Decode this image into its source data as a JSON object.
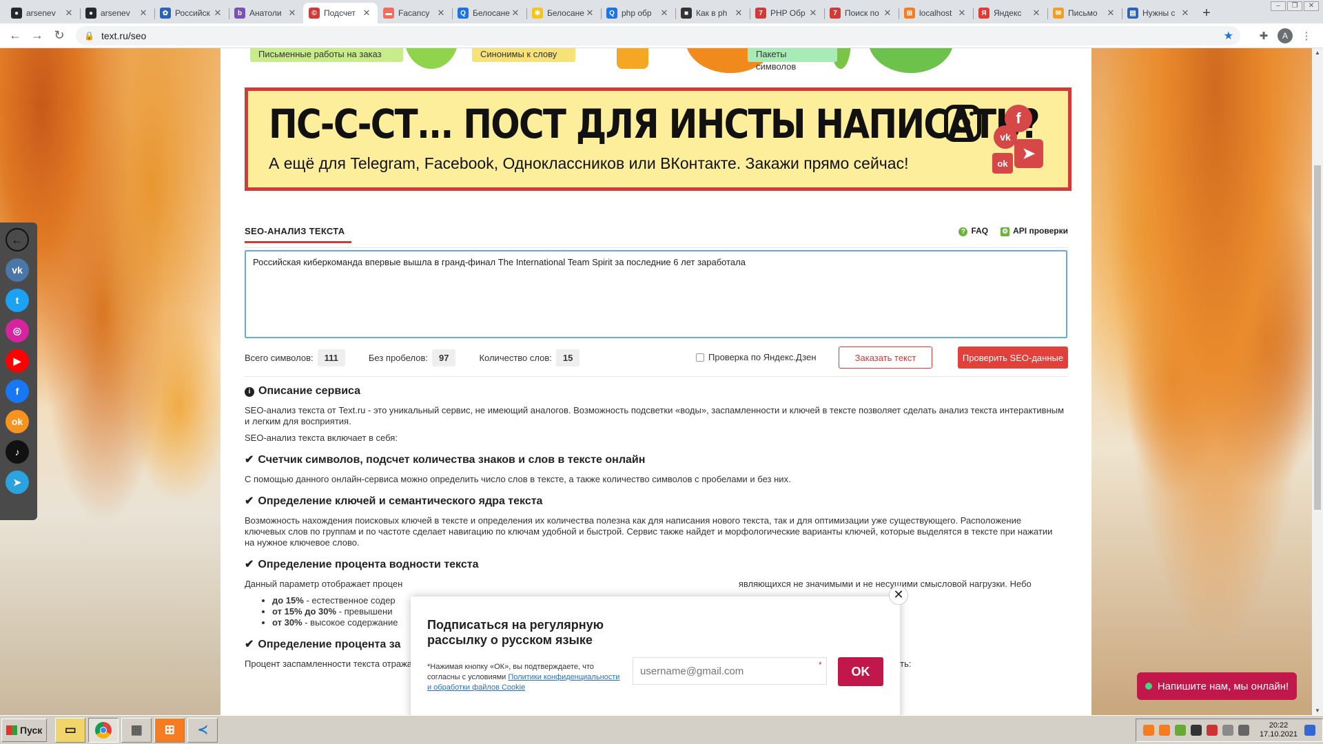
{
  "browser": {
    "tabs": [
      {
        "title": "arsenev",
        "icon": "github-icon",
        "color": "#24292e",
        "glyph": "●"
      },
      {
        "title": "arsenev",
        "icon": "github-icon",
        "color": "#24292e",
        "glyph": "●"
      },
      {
        "title": "Российск",
        "icon": "gosuslugi-icon",
        "color": "#2b63b6",
        "glyph": "✿"
      },
      {
        "title": "Анатоли",
        "icon": "bootstrap-icon",
        "color": "#7952b3",
        "glyph": "b"
      },
      {
        "title": "Подсчет",
        "icon": "textru-icon",
        "color": "#d23a3a",
        "glyph": "©",
        "active": true
      },
      {
        "title": "Facancy",
        "icon": "facancy-icon",
        "color": "#f26b5b",
        "glyph": "▬"
      },
      {
        "title": "Белосане",
        "icon": "search-icon",
        "color": "#1a73e8",
        "glyph": "Q"
      },
      {
        "title": "Белосане",
        "icon": "yandex-zen-icon",
        "color": "#f5c518",
        "glyph": "✱"
      },
      {
        "title": "php обр",
        "icon": "search-icon",
        "color": "#1a73e8",
        "glyph": "Q"
      },
      {
        "title": "Как в ph",
        "icon": "site-icon",
        "color": "#333333",
        "glyph": "■"
      },
      {
        "title": "PHP Обр",
        "icon": "php-site-icon",
        "color": "#d23a3a",
        "glyph": "7"
      },
      {
        "title": "Поиск по",
        "icon": "php-site-icon",
        "color": "#d23a3a",
        "glyph": "7"
      },
      {
        "title": "localhost",
        "icon": "xampp-icon",
        "color": "#f57c20",
        "glyph": "⊞"
      },
      {
        "title": "Яндекс",
        "icon": "yandex-icon",
        "color": "#e53935",
        "glyph": "Я"
      },
      {
        "title": "Письмо",
        "icon": "mail-icon",
        "color": "#f0a01e",
        "glyph": "✉"
      },
      {
        "title": "Нужны с",
        "icon": "site-icon",
        "color": "#2b63b6",
        "glyph": "▤"
      }
    ],
    "close_glyph": "✕",
    "newtab_glyph": "+",
    "url": "text.ru/seo"
  },
  "promos": [
    {
      "label": "Письменные работы на заказ",
      "color": "#c9ec8a"
    },
    {
      "label": "Синонимы к слову",
      "color": "#f7e27a"
    },
    {
      "label": "Пакеты символов",
      "color": "#a8ebb6"
    }
  ],
  "banner": {
    "title": "ПС-С-СТ... ПОСТ ДЛЯ ИНСТЫ НАПИСАТЬ?",
    "subtitle": "А ещё для Telegram, Facebook, Одноклассников или ВКонтакте. Закажи прямо сейчас!",
    "border_color": "#d23a3a",
    "bg_color": "#fdee9c"
  },
  "seo": {
    "title": "SEO-АНАЛИЗ ТЕКСТА",
    "faq": "FAQ",
    "api": "API проверки",
    "text": "Российская кибер­команда впервые вышла в гранд-финал The International Team Spirit за последние 6 лет заработала",
    "stats": {
      "total_label": "Всего символов:",
      "total": "111",
      "nospace_label": "Без пробелов:",
      "nospace": "97",
      "words_label": "Количество слов:",
      "words": "15"
    },
    "zen_check": "Проверка по Яндекс.Дзен",
    "order_btn": "Заказать текст",
    "check_btn": "Проверить SEO-данные"
  },
  "description": {
    "heading": "Описание сервиса",
    "intro": "SEO-анализ текста от Text.ru - это уникальный сервис, не имеющий аналогов. Возможность подсветки «воды», заспамленности и ключей в тексте позволяет сделать анализ текста интерактивным и легким для восприятия.",
    "includes": "SEO-анализ текста включает в себя:",
    "sections": [
      {
        "title": "Счетчик символов, подсчет количества знаков и слов в тексте онлайн",
        "text": "С помощью данного онлайн-сервиса можно определить число слов в тексте, а также количество символов с пробелами и без них."
      },
      {
        "title": "Определение ключей и семантического ядра текста",
        "text": "Возможность нахождения поисковых ключей в тексте и определения их количества полезна как для написания нового текста, так и для оптимизации уже существующего. Расположение ключевых слов по группам и по частоте сделает навигацию по ключам удобной и быстрой. Сервис также найдет и морфологические варианты ключей, которые выделятся в тексте при нажатии на нужное ключевое слово."
      },
      {
        "title": "Определение процента водности текста",
        "text": "Данный параметр отображает процен                                                                                                                                       являющихся не значимыми и не несущими смысловой нагрузки. Небо"
      }
    ],
    "water_list": [
      {
        "bold": "до 15%",
        "rest": " - естественное содер"
      },
      {
        "bold": "от 15% до 30%",
        "rest": " - превышени"
      },
      {
        "bold": "от 30%",
        "rest": " - высокое содержание"
      }
    ],
    "spam_title": "Определение процента за",
    "spam_text": "Процент заспамленности текста отражает количество поисковых ключевых слов в тексте. Чем больше в тексте ключевых слов, тем выше его заспамленность:"
  },
  "share": [
    {
      "icon": "back-arrow-icon",
      "glyph": "←",
      "color": "transparent"
    },
    {
      "icon": "vk-icon",
      "glyph": "vk",
      "color": "#4a76a8"
    },
    {
      "icon": "twitter-icon",
      "glyph": "t",
      "color": "#1da1f2"
    },
    {
      "icon": "instagram-icon",
      "glyph": "◎",
      "color": "#d6249f"
    },
    {
      "icon": "youtube-icon",
      "glyph": "▶",
      "color": "#ff0000"
    },
    {
      "icon": "facebook-icon",
      "glyph": "f",
      "color": "#1877f2"
    },
    {
      "icon": "odnoklassniki-icon",
      "glyph": "ok",
      "color": "#f7931e"
    },
    {
      "icon": "tiktok-icon",
      "glyph": "♪",
      "color": "#111111"
    },
    {
      "icon": "telegram-icon",
      "glyph": "➤",
      "color": "#2aa3df"
    }
  ],
  "popup": {
    "title": "Подписаться на регулярную рассылку о русском языке",
    "note": "*Нажимая кнопку «ОК», вы подтверждаете, что согласны с условиями ",
    "link": "Политики конфиденциальности и обработки файлов Cookie",
    "placeholder": "username@gmail.com",
    "required": "*",
    "ok": "OK",
    "close": "✕"
  },
  "chat": "Напишите нам, мы онлайн!",
  "taskbar": {
    "start": "Пуск",
    "time": "20:22",
    "date": "17.10.2021"
  }
}
